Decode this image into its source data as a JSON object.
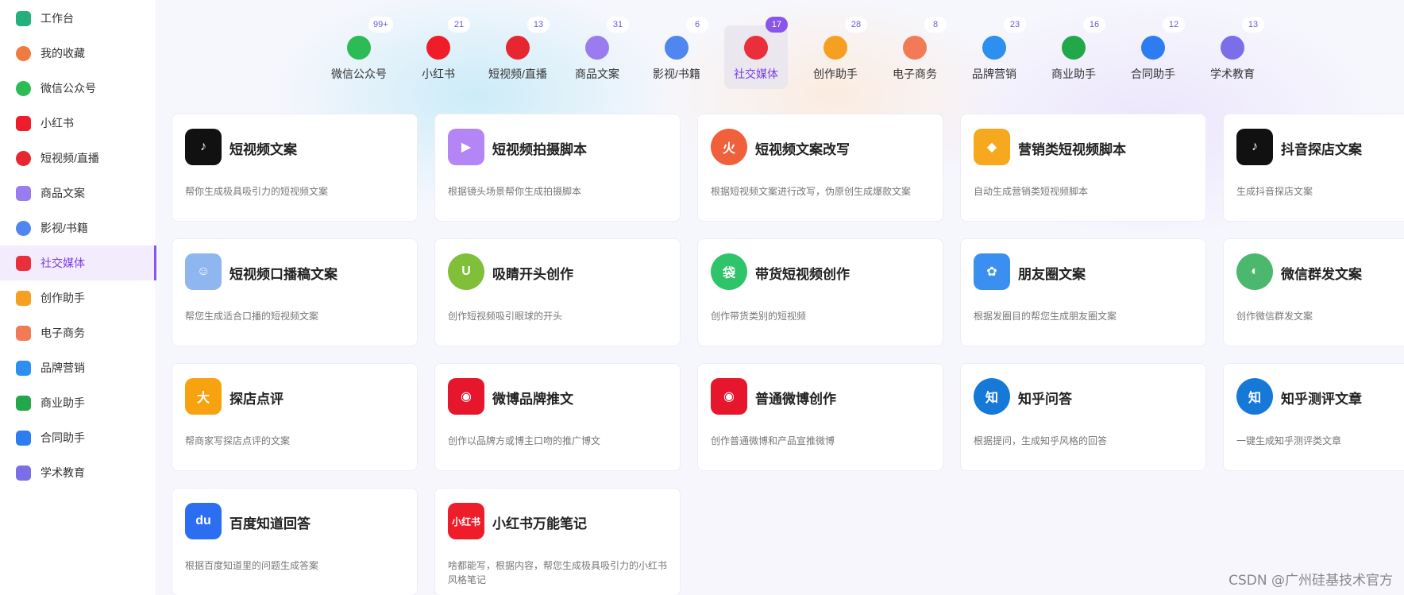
{
  "sidebar": {
    "items": [
      {
        "label": "工作台",
        "icon": "dashboard-icon",
        "color": "#22b07d"
      },
      {
        "label": "我的收藏",
        "icon": "star-icon",
        "color": "#f07b3f"
      },
      {
        "label": "微信公众号",
        "icon": "wechat-icon",
        "color": "#2dbb55"
      },
      {
        "label": "小红书",
        "icon": "xiaohongshu-icon",
        "color": "#ee1d29"
      },
      {
        "label": "短视频/直播",
        "icon": "video-icon",
        "color": "#e8262f"
      },
      {
        "label": "商品文案",
        "icon": "goods-icon",
        "color": "#9b7cf0"
      },
      {
        "label": "影视/书籍",
        "icon": "film-icon",
        "color": "#4f86f0"
      },
      {
        "label": "社交媒体",
        "icon": "cube-icon",
        "color": "#ea2e3b"
      },
      {
        "label": "创作助手",
        "icon": "pen-doc-icon",
        "color": "#f6a021"
      },
      {
        "label": "电子商务",
        "icon": "shop-icon",
        "color": "#f37a56"
      },
      {
        "label": "品牌营销",
        "icon": "users-icon",
        "color": "#2d8ff0"
      },
      {
        "label": "商业助手",
        "icon": "bar-chart-icon",
        "color": "#22a84a"
      },
      {
        "label": "合同助手",
        "icon": "contract-icon",
        "color": "#2d7cf0"
      },
      {
        "label": "学术教育",
        "icon": "graduation-cap-icon",
        "color": "#7b6ee8"
      }
    ],
    "active_index": 7
  },
  "categories": [
    {
      "label": "微信公众号",
      "badge": "99+",
      "icon": "wechat-icon",
      "color": "#2dbb55"
    },
    {
      "label": "小红书",
      "badge": "21",
      "icon": "xiaohongshu-icon",
      "color": "#ee1d29"
    },
    {
      "label": "短视频/直播",
      "badge": "13",
      "icon": "video-icon",
      "color": "#e8262f"
    },
    {
      "label": "商品文案",
      "badge": "31",
      "icon": "goods-icon",
      "color": "#9b7cf0"
    },
    {
      "label": "影视/书籍",
      "badge": "6",
      "icon": "film-icon",
      "color": "#4f86f0"
    },
    {
      "label": "社交媒体",
      "badge": "17",
      "icon": "cube-icon",
      "color": "#ea2e3b"
    },
    {
      "label": "创作助手",
      "badge": "28",
      "icon": "pen-doc-icon",
      "color": "#f6a021"
    },
    {
      "label": "电子商务",
      "badge": "8",
      "icon": "shop-icon",
      "color": "#f37a56"
    },
    {
      "label": "品牌营销",
      "badge": "23",
      "icon": "users-icon",
      "color": "#2d8ff0"
    },
    {
      "label": "商业助手",
      "badge": "16",
      "icon": "bar-chart-icon",
      "color": "#22a84a"
    },
    {
      "label": "合同助手",
      "badge": "12",
      "icon": "contract-icon",
      "color": "#2d7cf0"
    },
    {
      "label": "学术教育",
      "badge": "13",
      "icon": "graduation-cap-icon",
      "color": "#7b6ee8"
    }
  ],
  "active_category": 5,
  "cards": [
    {
      "title": "短视频文案",
      "desc": "帮你生成极具吸引力的短视频文案",
      "icon": "tiktok-icon",
      "color": "#111111",
      "glyph": "♪"
    },
    {
      "title": "短视频拍摄脚本",
      "desc": "根据镜头场景帮你生成拍摄脚本",
      "icon": "video-camera-icon",
      "color": "#b486f5",
      "glyph": "▶"
    },
    {
      "title": "短视频文案改写",
      "desc": "根据短视频文案进行改写，伪原创生成爆款文案",
      "icon": "flame-icon",
      "color": "#f0603a",
      "glyph": "火"
    },
    {
      "title": "营销类短视频脚本",
      "desc": "自动生成营销类短视频脚本",
      "icon": "diamond-icon",
      "color": "#f6a91e",
      "glyph": "◆"
    },
    {
      "title": "抖音探店文案",
      "desc": "生成抖音探店文案",
      "icon": "tiktok-icon",
      "color": "#111111",
      "glyph": "♪"
    },
    {
      "title": "短视频口播稿文案",
      "desc": "帮您生成适合口播的短视频文案",
      "icon": "boy-avatar-icon",
      "color": "#8fb6ee",
      "glyph": "☺"
    },
    {
      "title": "吸睛开头创作",
      "desc": "创作短视频吸引眼球的开头",
      "icon": "magnet-icon",
      "color": "#7fbf3a",
      "glyph": "U"
    },
    {
      "title": "带货短视频创作",
      "desc": "创作带货类别的短视频",
      "icon": "shopping-bag-icon",
      "color": "#2fc36a",
      "glyph": "袋"
    },
    {
      "title": "朋友圈文案",
      "desc": "根据发圈目的帮您生成朋友圈文案",
      "icon": "aperture-icon",
      "color": "#3a8ff0",
      "glyph": "✿"
    },
    {
      "title": "微信群发文案",
      "desc": "创作微信群发文案",
      "icon": "wechat-icon",
      "color": "#4cb86e",
      "glyph": "◐"
    },
    {
      "title": "探店点评",
      "desc": "帮商家写探店点评的文案",
      "icon": "dianping-icon",
      "color": "#f7a30f",
      "glyph": "大"
    },
    {
      "title": "微博品牌推文",
      "desc": "创作以品牌方或博主口吻的推广博文",
      "icon": "weibo-icon",
      "color": "#e6162d",
      "glyph": "◉"
    },
    {
      "title": "普通微博创作",
      "desc": "创作普通微博和产品宣推微博",
      "icon": "weibo-icon",
      "color": "#e6162d",
      "glyph": "◉"
    },
    {
      "title": "知乎问答",
      "desc": "根据提问，生成知乎风格的回答",
      "icon": "zhihu-icon",
      "color": "#1679d8",
      "glyph": "知"
    },
    {
      "title": "知乎测评文章",
      "desc": "一键生成知乎测评类文章",
      "icon": "zhihu-icon",
      "color": "#1679d8",
      "glyph": "知"
    },
    {
      "title": "百度知道回答",
      "desc": "根据百度知道里的问题生成答案",
      "icon": "baidu-icon",
      "color": "#2c6ef2",
      "glyph": "du"
    },
    {
      "title": "小红书万能笔记",
      "desc": "啥都能写，根据内容，帮您生成极具吸引力的小红书风格笔记",
      "icon": "xiaohongshu-icon",
      "color": "#ee1d29",
      "glyph": "小红书"
    }
  ],
  "watermark": "CSDN @广州硅基技术官方"
}
